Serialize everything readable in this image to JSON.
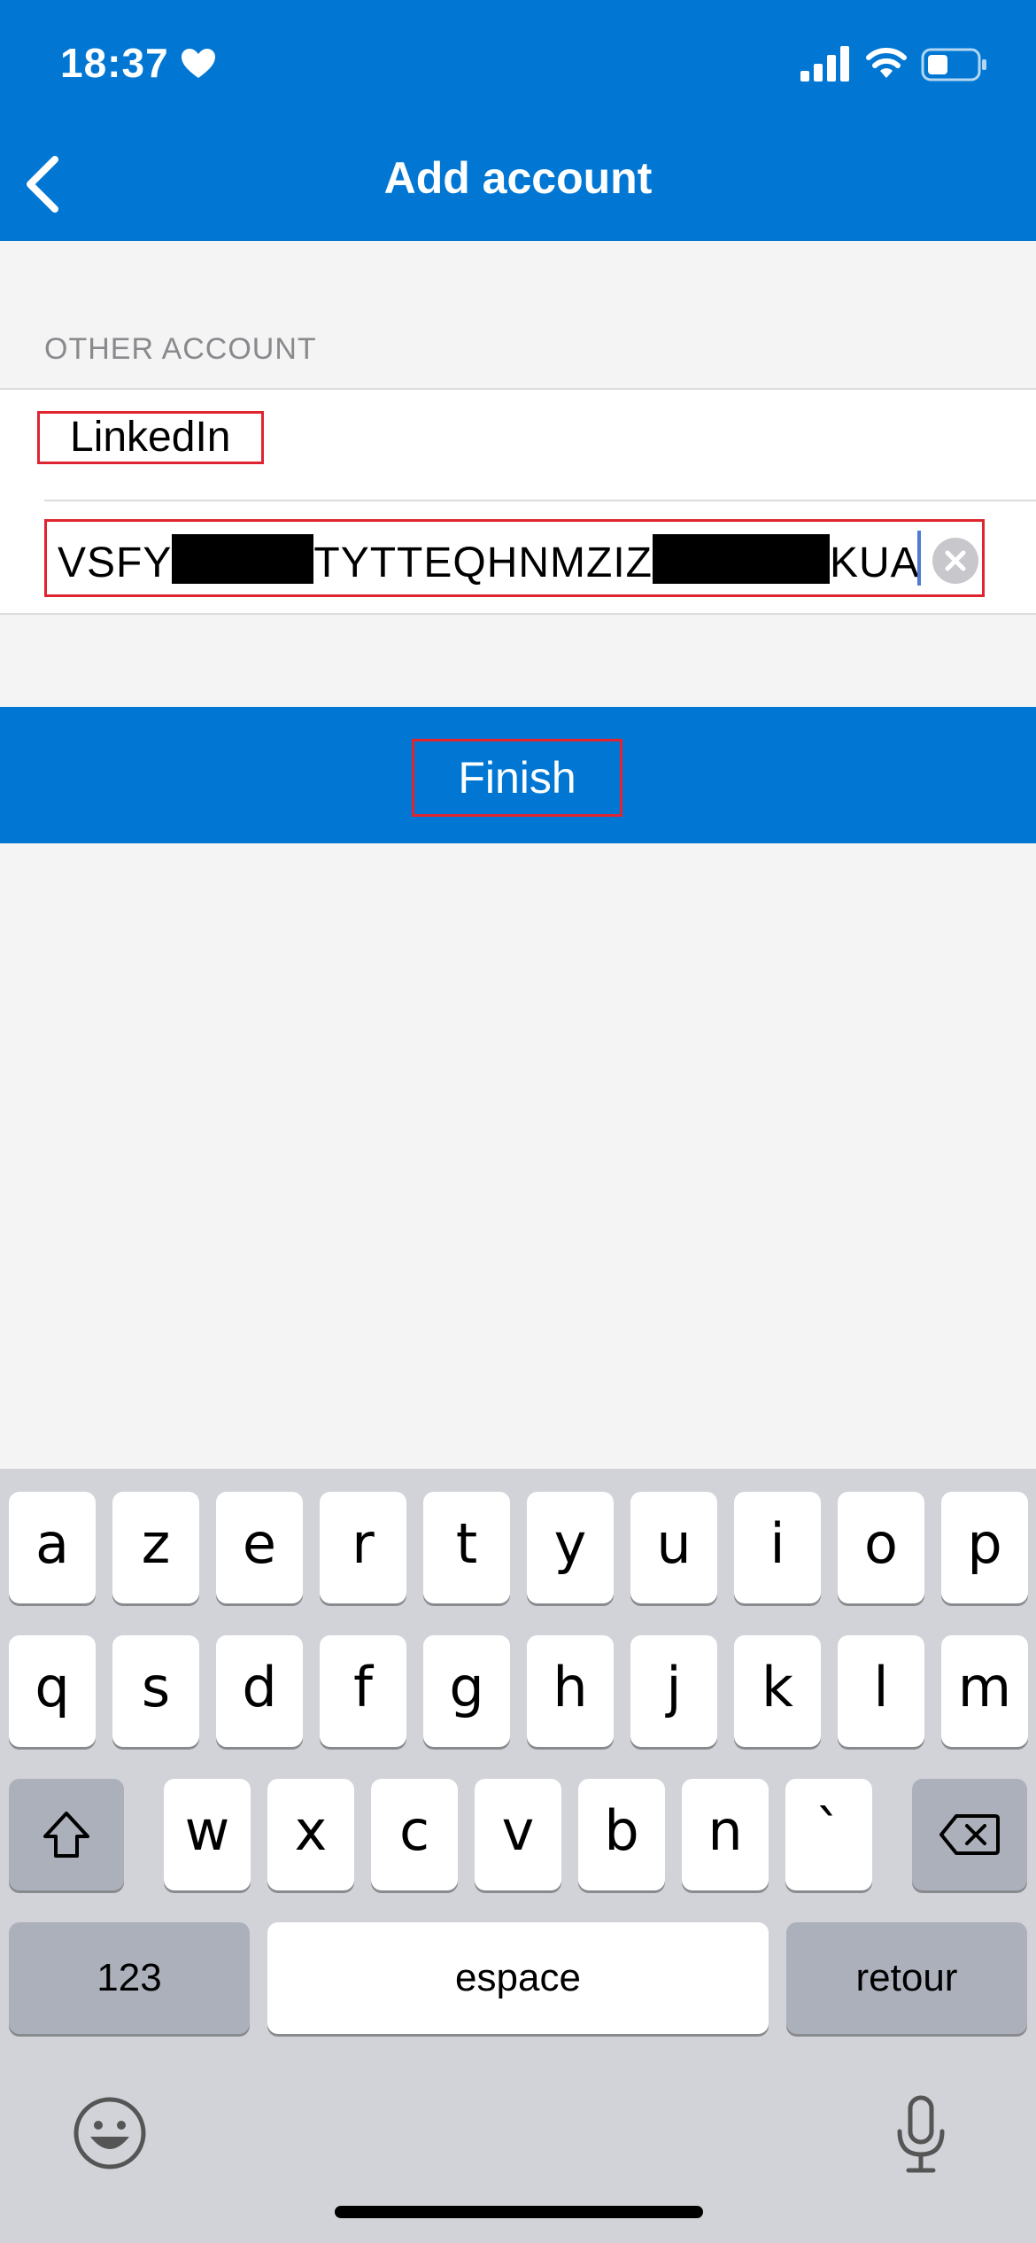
{
  "status_bar": {
    "time": "18:37"
  },
  "header": {
    "title": "Add account"
  },
  "section": {
    "label": "OTHER ACCOUNT"
  },
  "form": {
    "account_name": "LinkedIn",
    "secret_key_parts": [
      "VSFY",
      "TYTTEQHNMZIZ",
      "KUA"
    ]
  },
  "finish": {
    "label": "Finish"
  },
  "keyboard": {
    "row1": [
      "a",
      "z",
      "e",
      "r",
      "t",
      "y",
      "u",
      "i",
      "o",
      "p"
    ],
    "row2": [
      "q",
      "s",
      "d",
      "f",
      "g",
      "h",
      "j",
      "k",
      "l",
      "m"
    ],
    "row3": [
      "w",
      "x",
      "c",
      "v",
      "b",
      "n",
      "`"
    ],
    "numbers_label": "123",
    "space_label": "espace",
    "return_label": "retour"
  },
  "colors": {
    "accent": "#0177d3",
    "highlight": "#e0242f"
  }
}
